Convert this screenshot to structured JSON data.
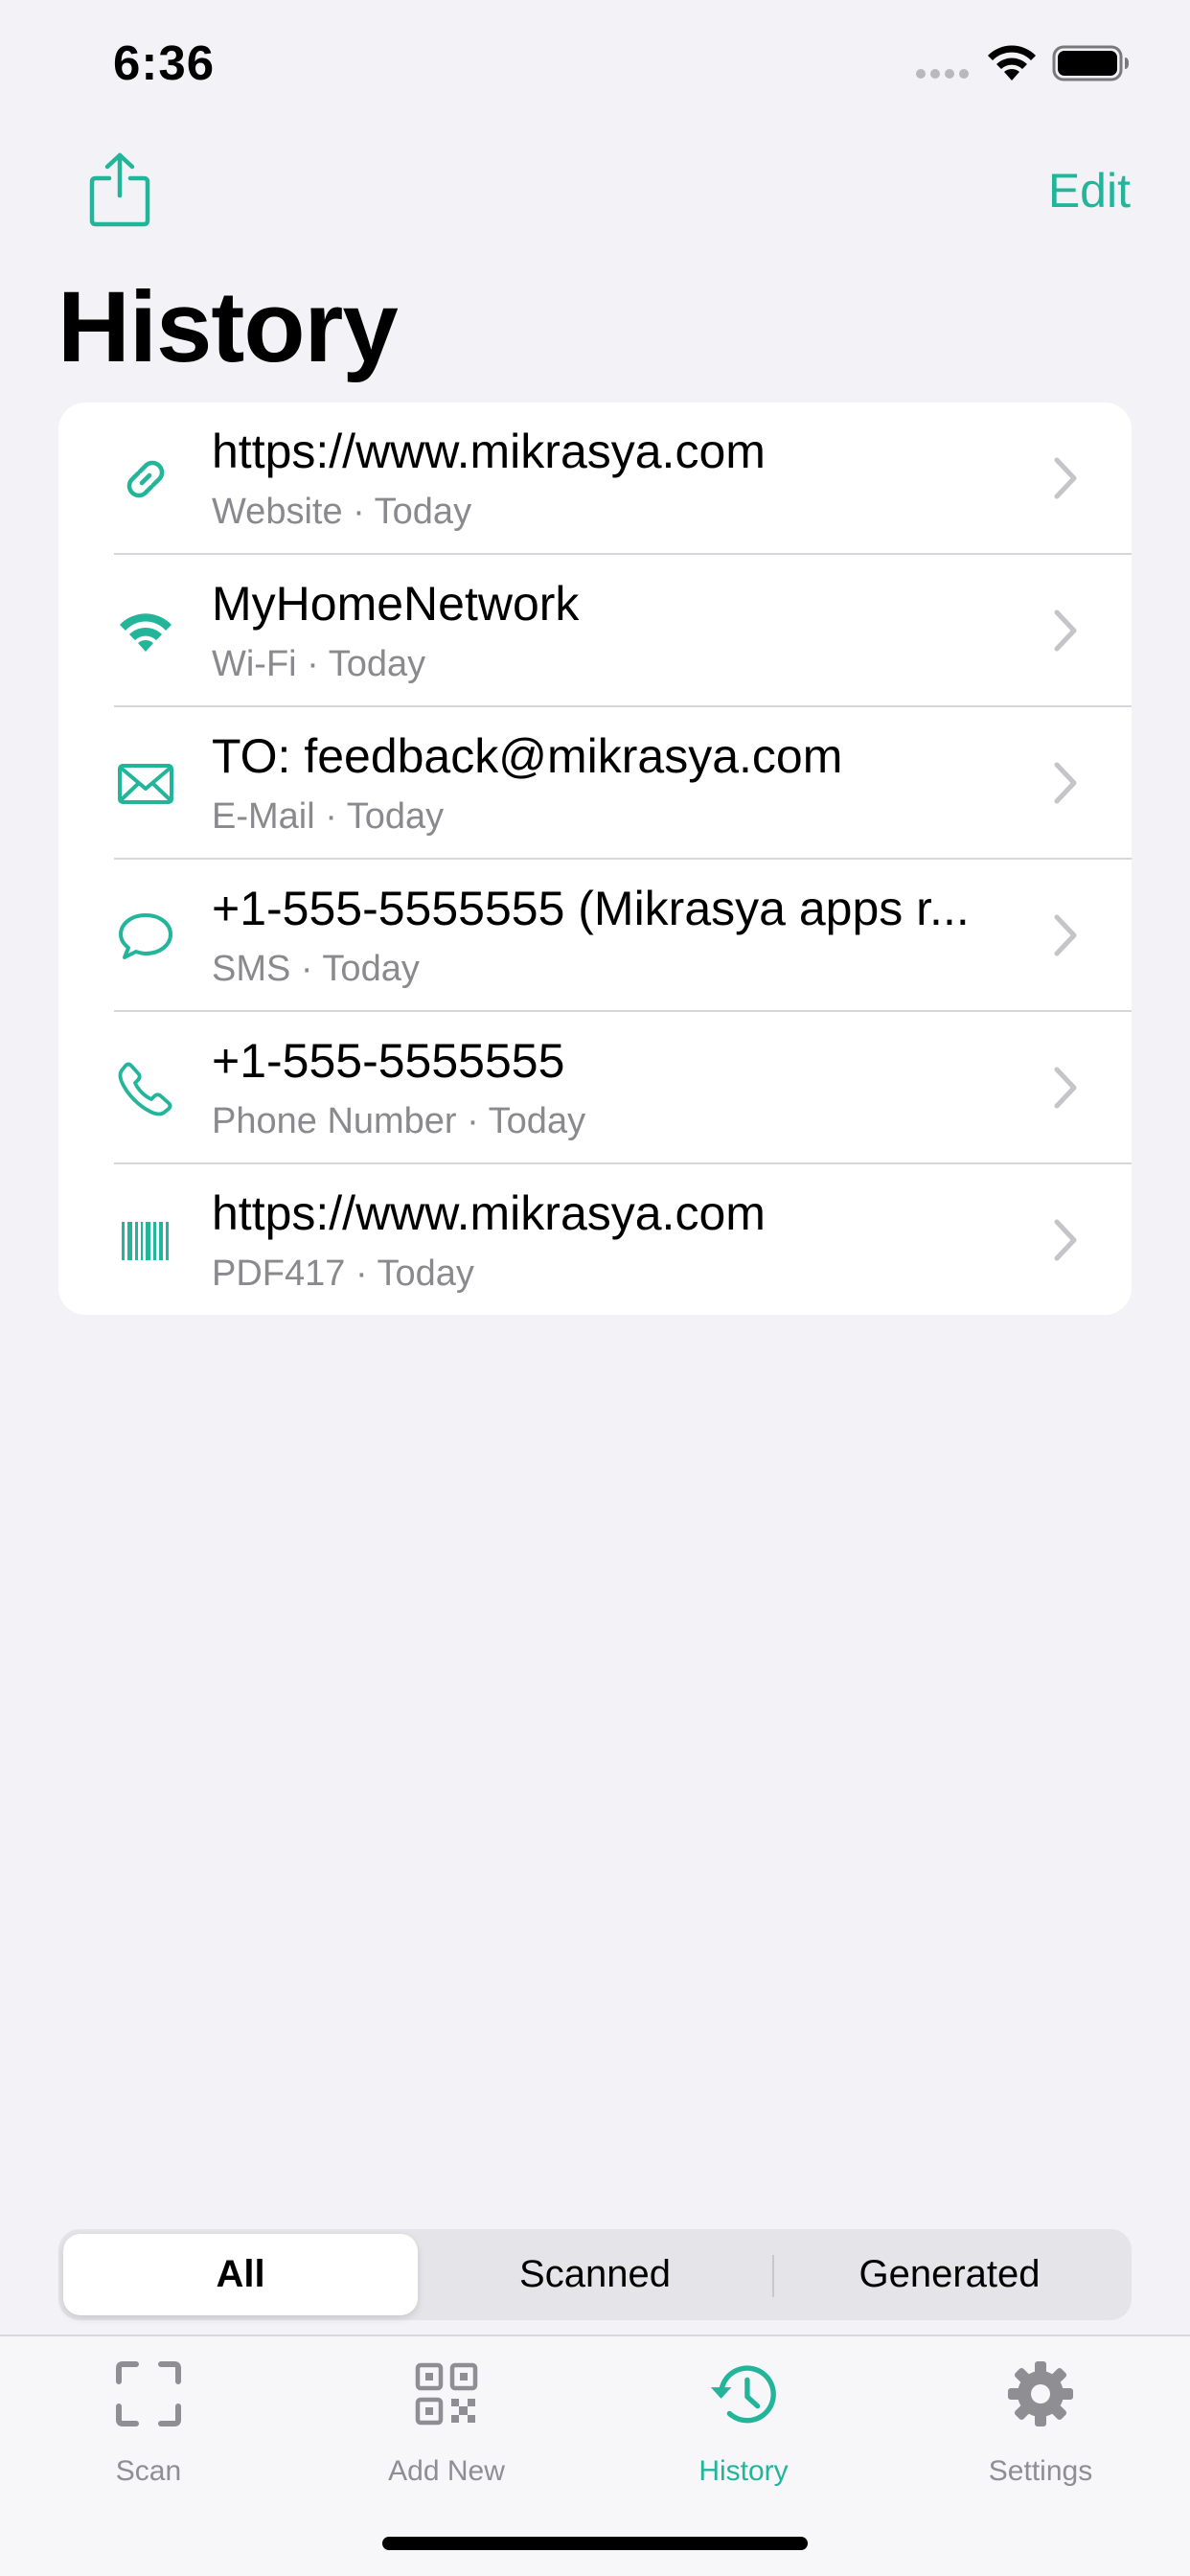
{
  "status_bar": {
    "time": "6:36"
  },
  "nav": {
    "edit_label": "Edit",
    "title": "History"
  },
  "colors": {
    "accent": "#22b59a",
    "secondary_text": "#8a8a8e",
    "tab_inactive": "#8e8e93"
  },
  "history": {
    "items": [
      {
        "icon": "link-icon",
        "title": "https://www.mikrasya.com",
        "subtitle": "Website · Today"
      },
      {
        "icon": "wifi-icon",
        "title": "MyHomeNetwork",
        "subtitle": "Wi-Fi · Today"
      },
      {
        "icon": "envelope-icon",
        "title": "TO: feedback@mikrasya.com",
        "subtitle": "E-Mail · Today"
      },
      {
        "icon": "message-bubble-icon",
        "title": "+1-555-5555555 (Mikrasya apps r...",
        "subtitle": "SMS · Today"
      },
      {
        "icon": "phone-icon",
        "title": "+1-555-5555555",
        "subtitle": "Phone Number · Today"
      },
      {
        "icon": "barcode-icon",
        "title": "https://www.mikrasya.com",
        "subtitle": "PDF417 · Today"
      }
    ]
  },
  "filter": {
    "segments": [
      {
        "label": "All"
      },
      {
        "label": "Scanned"
      },
      {
        "label": "Generated"
      }
    ],
    "selected": "All"
  },
  "tabs": [
    {
      "label": "Scan",
      "icon": "scan-frame-icon"
    },
    {
      "label": "Add New",
      "icon": "qr-code-icon"
    },
    {
      "label": "History",
      "icon": "clock-history-icon"
    },
    {
      "label": "Settings",
      "icon": "gear-icon"
    }
  ],
  "active_tab": "History"
}
